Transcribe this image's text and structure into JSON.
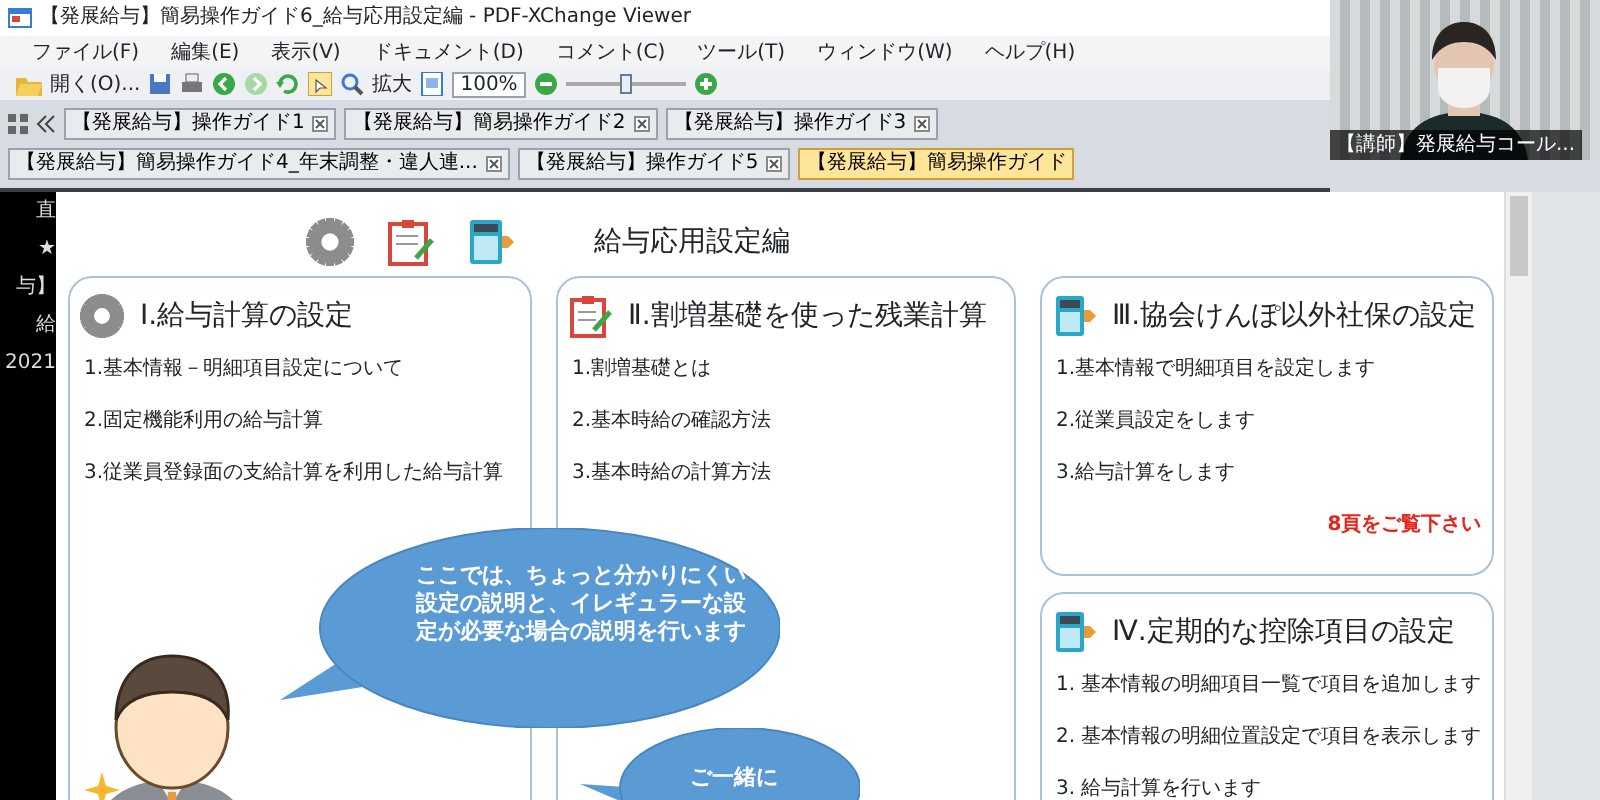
{
  "window": {
    "title": "【発展給与】簡易操作ガイド6_給与応用設定編 - PDF-XChange Viewer"
  },
  "menu": [
    "ファイル(F)",
    "編集(E)",
    "表示(V)",
    "ドキュメント(D)",
    "コメント(C)",
    "ツール(T)",
    "ウィンドウ(W)",
    "ヘルプ(H)"
  ],
  "toolbar": {
    "open_label": "開く(O)...",
    "zoom_in_label": "拡大",
    "zoom": "100%",
    "zoom_slider": {
      "level": 0.5
    }
  },
  "tabs": [
    {
      "label": "【発展給与】操作ガイド1",
      "selected": false
    },
    {
      "label": "【発展給与】簡易操作ガイド2",
      "selected": false
    },
    {
      "label": "【発展給与】操作ガイド3",
      "selected": false
    },
    {
      "label": "【発展給与】簡易操作ガイド4_年末調整・違人連...",
      "selected": false
    },
    {
      "label": "【発展給与】操作ガイド5",
      "selected": false
    },
    {
      "label": "【発展給与】簡易操作ガイド",
      "selected": true
    }
  ],
  "video": {
    "kind": "picture",
    "caption": "【講師】発展給与コール..."
  },
  "side_strip": [
    "直",
    "★",
    "与】",
    "給",
    "2021"
  ],
  "slide": {
    "title": "給与応用設定編",
    "sections": [
      {
        "title": "Ⅰ.給与計算の設定",
        "items": [
          "1.基本情報－明細項目設定について",
          "2.固定機能利用の給与計算",
          "3.従業員登録面の支給計算を利用した給与計算"
        ]
      },
      {
        "title": "Ⅱ.割増基礎を使った残業計算",
        "items": [
          "1.割増基礎とは",
          "2.基本時給の確認方法",
          "3.基本時給の計算方法"
        ]
      },
      {
        "title": "Ⅲ.協会けんぽ以外社保の設定",
        "items": [
          "1.基本情報で明細項目を設定します",
          "2.従業員設定をします",
          "3.給与計算をします"
        ],
        "note": "8頁をご覧下さい"
      },
      {
        "title": "Ⅳ.定期的な控除項目の設定",
        "items": [
          "1. 基本情報の明細項目一覧で項目を追加します",
          "2. 基本情報の明細位置設定で項目を表示します",
          "3. 給与計算を行います"
        ]
      }
    ],
    "bubbles": [
      "ここでは、ちょっと分かりにくい設定の説明と、イレギュラーな設定が必要な場合の説明を行います",
      "ご一緒に"
    ]
  }
}
